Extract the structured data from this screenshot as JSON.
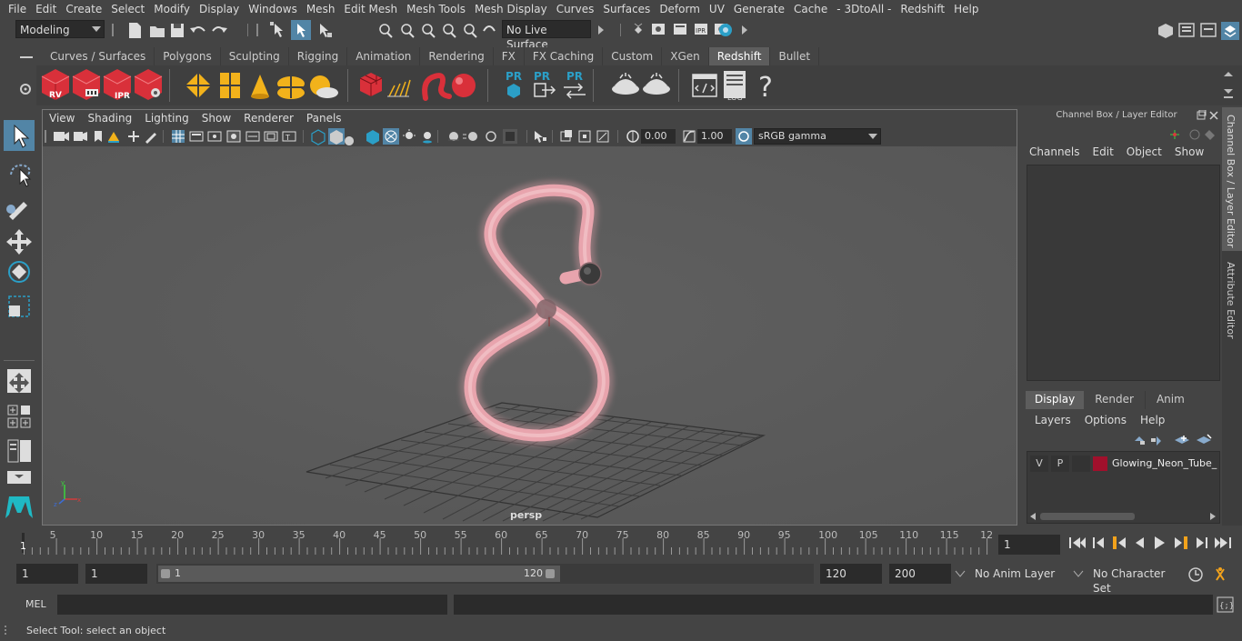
{
  "menu": [
    "File",
    "Edit",
    "Create",
    "Select",
    "Modify",
    "Display",
    "Windows",
    "Mesh",
    "Edit Mesh",
    "Mesh Tools",
    "Mesh Display",
    "Curves",
    "Surfaces",
    "Deform",
    "UV",
    "Generate",
    "Cache",
    "- 3DtoAll -",
    "Redshift",
    "Help"
  ],
  "status": {
    "workspace": "Modeling",
    "live_surface": "No Live Surface"
  },
  "shelf_tabs": [
    "Curves / Surfaces",
    "Polygons",
    "Sculpting",
    "Rigging",
    "Animation",
    "Rendering",
    "FX",
    "FX Caching",
    "Custom",
    "XGen",
    "Redshift",
    "Bullet"
  ],
  "shelf_active": "Redshift",
  "shelf_icons": {
    "rv": "RV",
    "ipr": "IPR",
    "pr1": "PR",
    "pr2": "PR",
    "pr3": "PR",
    "log": "LOG",
    "help": "?"
  },
  "viewport": {
    "menu": [
      "View",
      "Shading",
      "Lighting",
      "Show",
      "Renderer",
      "Panels"
    ],
    "exposure": "0.00",
    "gamma": "1.00",
    "colorspace": "sRGB gamma",
    "camera_label": "persp"
  },
  "channel_box": {
    "title": "Channel Box / Layer Editor",
    "menu": [
      "Channels",
      "Edit",
      "Object",
      "Show"
    ]
  },
  "layer_editor": {
    "tabs": [
      "Display",
      "Render",
      "Anim"
    ],
    "active_tab": "Display",
    "menu": [
      "Layers",
      "Options",
      "Help"
    ],
    "layer": {
      "v": "V",
      "p": "P",
      "name": "Glowing_Neon_Tube_",
      "color": "#a0102c"
    }
  },
  "side_tabs": [
    "Channel Box / Layer Editor",
    "Attribute Editor"
  ],
  "timeline": {
    "ticks": [
      "5",
      "10",
      "15",
      "20",
      "25",
      "30",
      "35",
      "40",
      "45",
      "50",
      "55",
      "60",
      "65",
      "70",
      "75",
      "80",
      "85",
      "90",
      "95",
      "100",
      "105",
      "110",
      "115",
      "12"
    ],
    "start_marker": "1",
    "current_frame": "1"
  },
  "range": {
    "start": "1",
    "playback_start": "1",
    "slider_start": "1",
    "slider_end": "120",
    "playback_end": "120",
    "end": "200",
    "anim_layer": "No Anim Layer",
    "character_set": "No Character Set"
  },
  "command": {
    "language": "MEL"
  },
  "help_line": "Select Tool: select an object",
  "colors": {
    "accent": "#5285a6",
    "redshift_red": "#d9303a",
    "shelf_yellow": "#f2b21b",
    "neon_pink": "#e8a4ad"
  }
}
